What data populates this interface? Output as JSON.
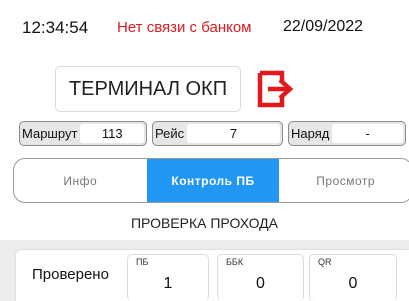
{
  "status_bar": {
    "time": "12:34:54",
    "connection_status": "Нет связи с банком",
    "date": "22/09/2022"
  },
  "header": {
    "title": "ТЕРМИНАЛ ОКП",
    "logout_icon": "logout-arrow-icon",
    "logout_color": "#e0191e"
  },
  "info": {
    "route_label": "Маршрут",
    "route_value": "113",
    "trip_label": "Рейс",
    "trip_value": "7",
    "order_label": "Наряд",
    "order_value": "-"
  },
  "tabs": [
    {
      "label": "Инфо",
      "active": false
    },
    {
      "label": "Контроль ПБ",
      "active": true
    },
    {
      "label": "Просмотр",
      "active": false
    }
  ],
  "accent_color": "#2196f3",
  "section_title": "ПРОВЕРКА ПРОХОДА",
  "counters": {
    "row_label": "Проверено",
    "items": [
      {
        "title": "ПБ",
        "value": "1"
      },
      {
        "title": "ББК",
        "value": "0"
      },
      {
        "title": "QR",
        "value": "0"
      }
    ]
  }
}
